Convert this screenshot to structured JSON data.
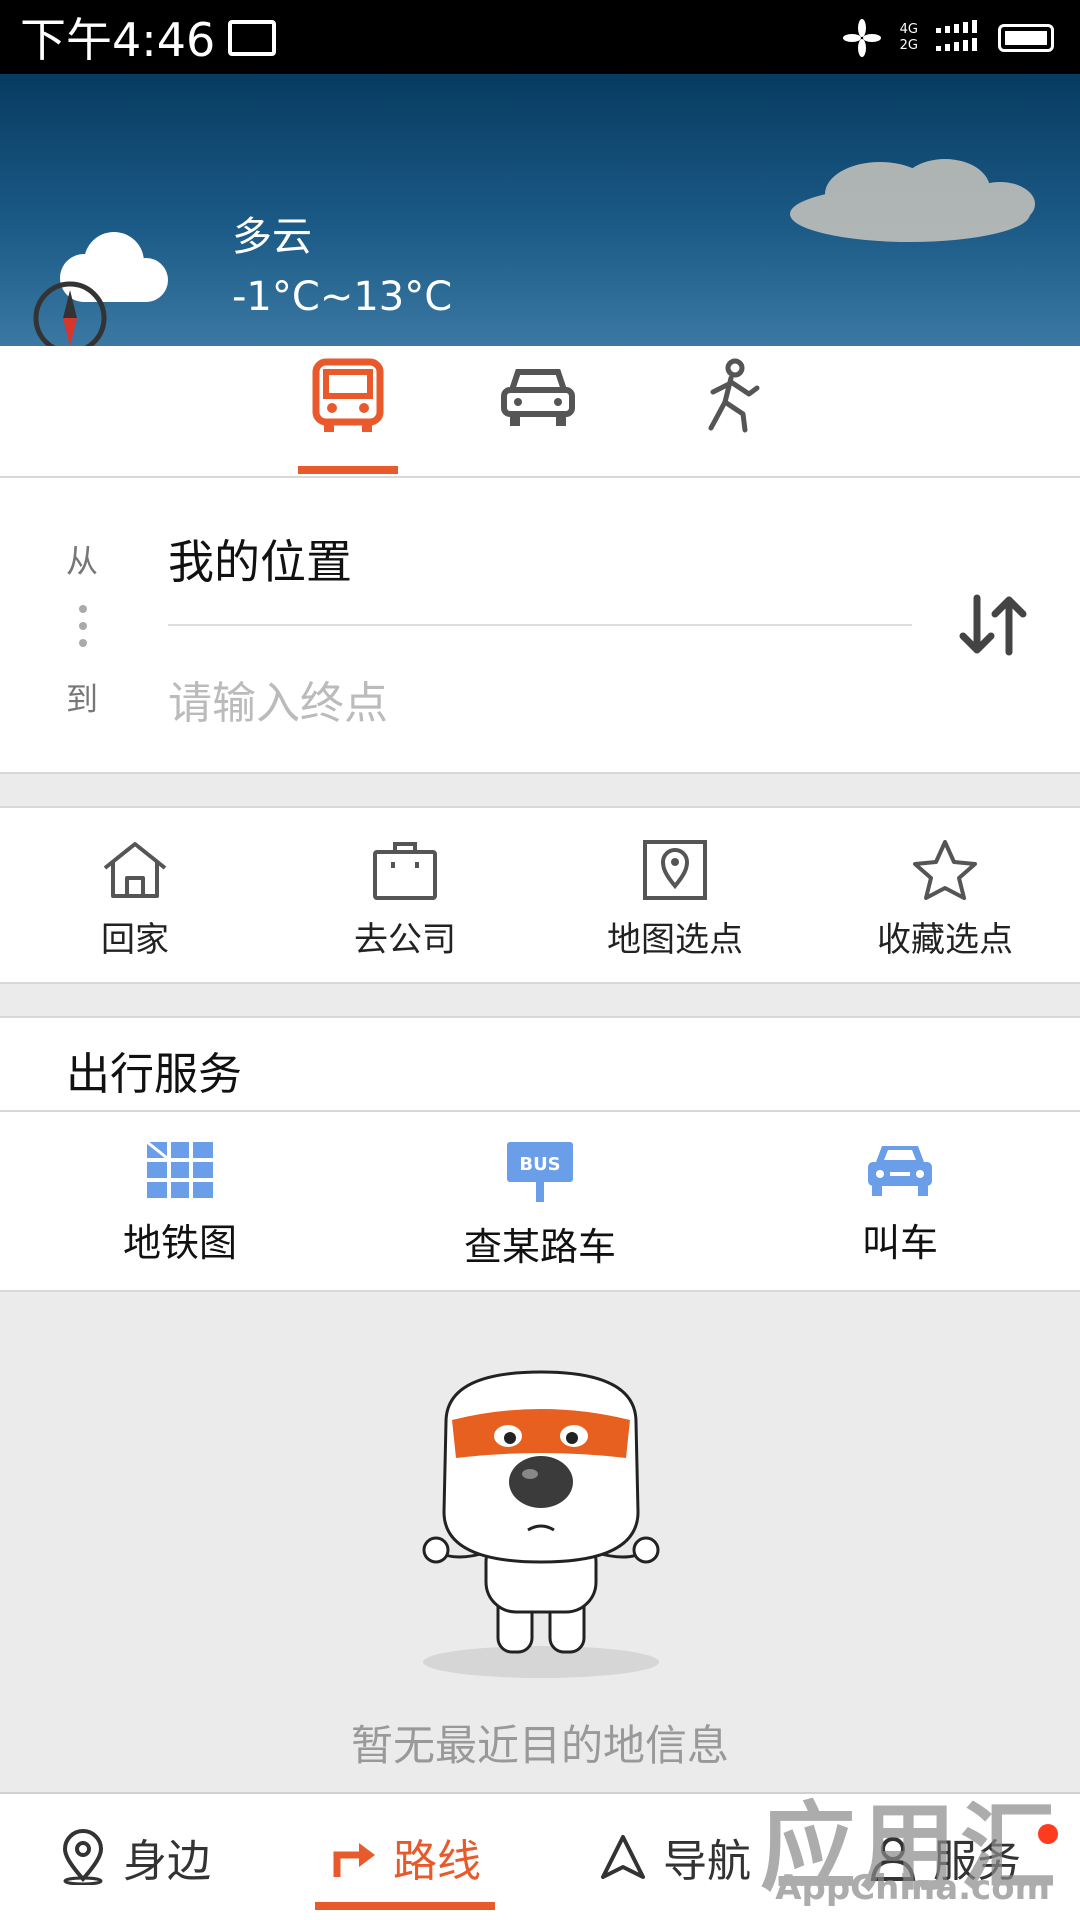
{
  "status_bar": {
    "time": "下午4:46",
    "network_4g": "4G",
    "network_2g": "2G"
  },
  "weather": {
    "condition": "多云",
    "temperature": "-1°C~13°C"
  },
  "transport_modes": [
    {
      "name": "bus",
      "active": true
    },
    {
      "name": "car",
      "active": false
    },
    {
      "name": "walk",
      "active": false
    }
  ],
  "route": {
    "from_label": "从",
    "to_label": "到",
    "from_value": "我的位置",
    "to_placeholder": "请输入终点"
  },
  "quick_actions": [
    {
      "label": "回家",
      "icon": "home-icon"
    },
    {
      "label": "去公司",
      "icon": "briefcase-icon"
    },
    {
      "label": "地图选点",
      "icon": "map-pin-icon"
    },
    {
      "label": "收藏选点",
      "icon": "star-icon"
    }
  ],
  "services": {
    "title": "出行服务",
    "items": [
      {
        "label": "地铁图",
        "icon": "subway-map-icon"
      },
      {
        "label": "查某路车",
        "icon": "bus-stop-icon",
        "icon_text": "BUS"
      },
      {
        "label": "叫车",
        "icon": "taxi-icon"
      }
    ]
  },
  "empty_state": {
    "message": "暂无最近目的地信息"
  },
  "bottom_nav": [
    {
      "label": "身边",
      "icon": "location-pin-icon",
      "active": false
    },
    {
      "label": "路线",
      "icon": "route-arrow-icon",
      "active": true
    },
    {
      "label": "导航",
      "icon": "navigation-arrow-icon",
      "active": false
    },
    {
      "label": "服务",
      "icon": "user-icon",
      "active": false
    }
  ],
  "watermark": {
    "brand": "应用汇",
    "site": "AppChina.com"
  },
  "colors": {
    "accent": "#e85a2b",
    "service_blue": "#6a9ee8",
    "hero_sky": "#0b4770"
  }
}
